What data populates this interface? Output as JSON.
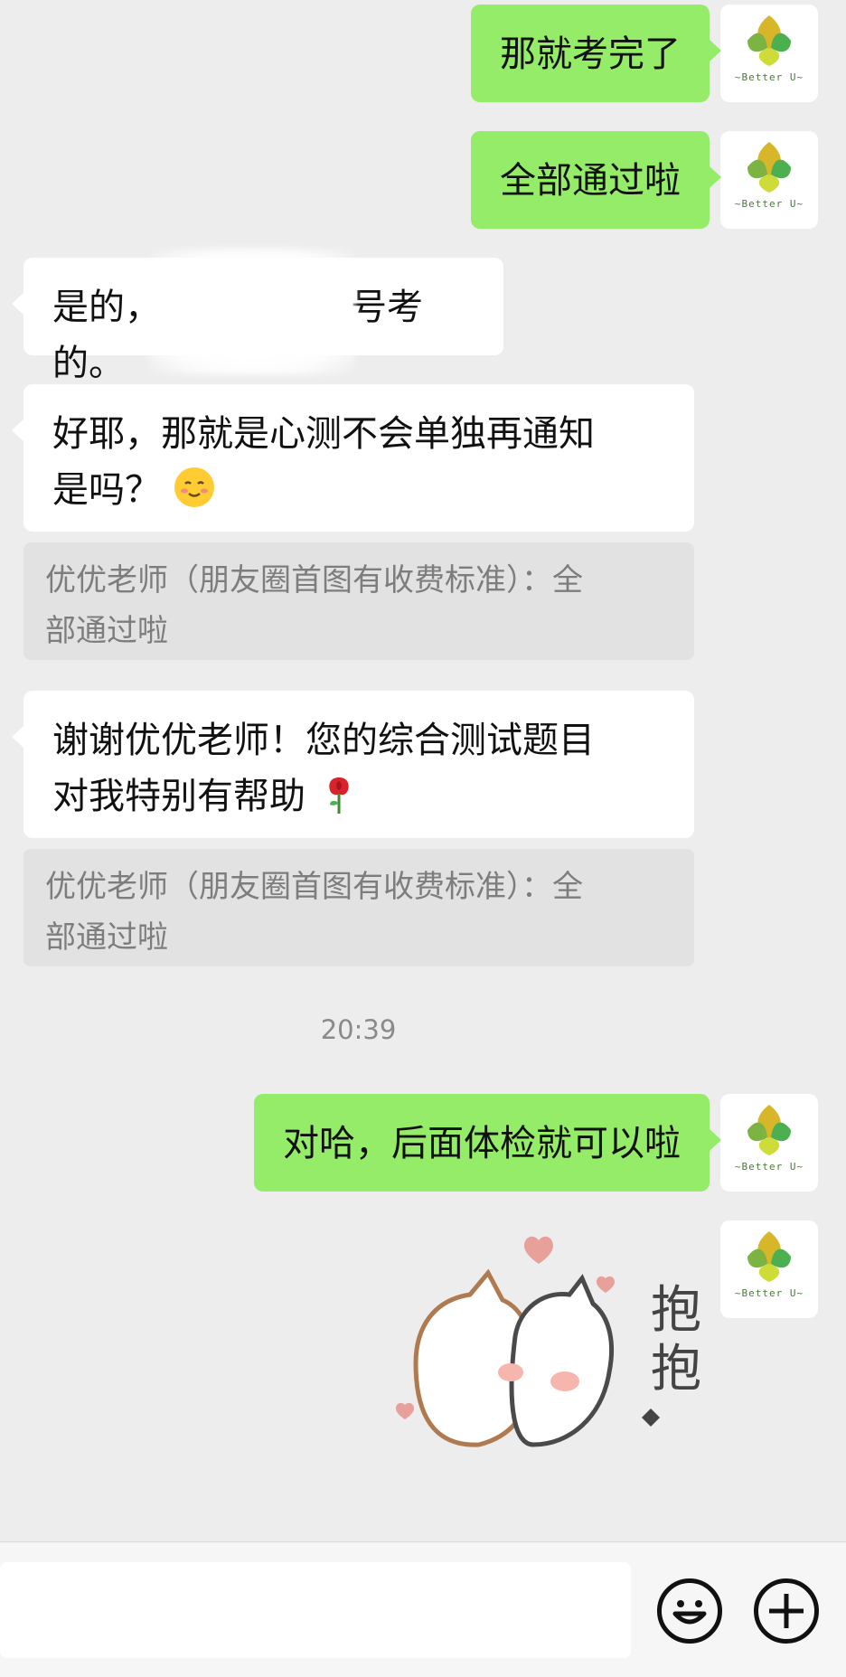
{
  "messages": {
    "m1": "那就考完了",
    "m2": "全部通过啦",
    "m3_pre": "是的，",
    "m3_post": "号考的。",
    "m4_line1": "好耶，那就是心测不会单独再通知",
    "m4_line2": "是吗？",
    "q1_line1": "优优老师（朋友圈首图有收费标准）：全",
    "q1_line2": "部通过啦",
    "m5_line1": "谢谢优优老师！您的综合测试题目",
    "m5_line2": "对我特别有帮助",
    "q2_line1": "优优老师（朋友圈首图有收费标准）：全",
    "q2_line2": "部通过啦",
    "time": "20:39",
    "m6": "对哈，后面体检就可以啦"
  },
  "avatar": {
    "label": "~Better U~",
    "icon": "better-u-logo"
  },
  "sticker": {
    "text1": "抱",
    "text2": "抱",
    "icon": "hug-sticker"
  },
  "toolbar": {
    "emoji_icon": "smiley-face-icon",
    "plus_icon": "plus-circle-icon"
  },
  "colors": {
    "background": "#ededed",
    "outgoing_bubble": "#95ec69",
    "incoming_bubble": "#ffffff",
    "quote_background": "#e2e2e2"
  }
}
